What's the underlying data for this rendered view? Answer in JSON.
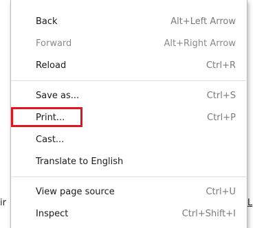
{
  "background": {
    "left_fragment": "ir",
    "right_fragment": "L"
  },
  "menu": {
    "items": [
      {
        "label": "Back",
        "shortcut": "Alt+Left Arrow",
        "enabled": true
      },
      {
        "label": "Forward",
        "shortcut": "Alt+Right Arrow",
        "enabled": false
      },
      {
        "label": "Reload",
        "shortcut": "Ctrl+R",
        "enabled": true
      },
      {
        "label": "Save as...",
        "shortcut": "Ctrl+S",
        "enabled": true
      },
      {
        "label": "Print...",
        "shortcut": "Ctrl+P",
        "enabled": true,
        "highlighted": true
      },
      {
        "label": "Cast...",
        "shortcut": "",
        "enabled": true
      },
      {
        "label": "Translate to English",
        "shortcut": "",
        "enabled": true
      },
      {
        "label": "View page source",
        "shortcut": "Ctrl+U",
        "enabled": true
      },
      {
        "label": "Inspect",
        "shortcut": "Ctrl+Shift+I",
        "enabled": true
      }
    ]
  },
  "colors": {
    "highlight_border": "#e0131f",
    "disabled_text": "#8a8a8a",
    "shortcut_text": "#7a7a7a"
  }
}
